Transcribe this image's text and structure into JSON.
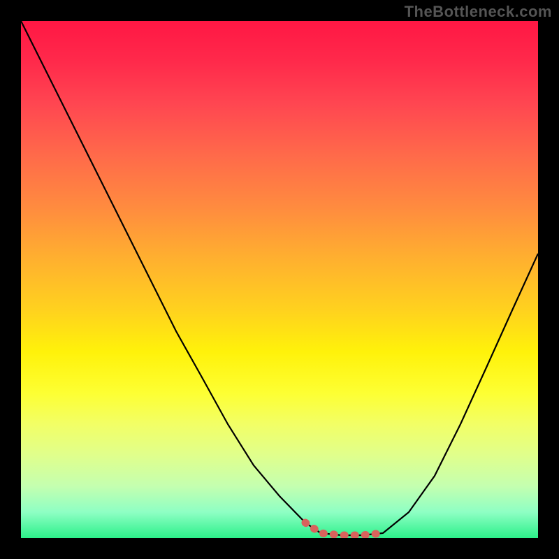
{
  "watermark": "TheBottleneck.com",
  "chart_data": {
    "type": "line",
    "title": "",
    "xlabel": "",
    "ylabel": "",
    "x": [
      0.0,
      0.05,
      0.1,
      0.15,
      0.2,
      0.25,
      0.3,
      0.35,
      0.4,
      0.45,
      0.5,
      0.55,
      0.58,
      0.62,
      0.66,
      0.7,
      0.75,
      0.8,
      0.85,
      0.9,
      0.95,
      1.0
    ],
    "values": [
      1.0,
      0.9,
      0.8,
      0.7,
      0.6,
      0.5,
      0.4,
      0.31,
      0.22,
      0.14,
      0.08,
      0.03,
      0.01,
      0.005,
      0.005,
      0.01,
      0.05,
      0.12,
      0.22,
      0.33,
      0.44,
      0.55
    ],
    "xlim": [
      0,
      1
    ],
    "ylim": [
      0,
      1
    ],
    "highlight_segment": {
      "start_x": 0.55,
      "end_x": 0.7,
      "color": "#d9635c"
    },
    "gradient_stops": [
      {
        "pos": 0.0,
        "color": "#ff1744"
      },
      {
        "pos": 0.5,
        "color": "#ffd21e"
      },
      {
        "pos": 0.75,
        "color": "#fdff33"
      },
      {
        "pos": 1.0,
        "color": "#2cf08a"
      }
    ]
  }
}
